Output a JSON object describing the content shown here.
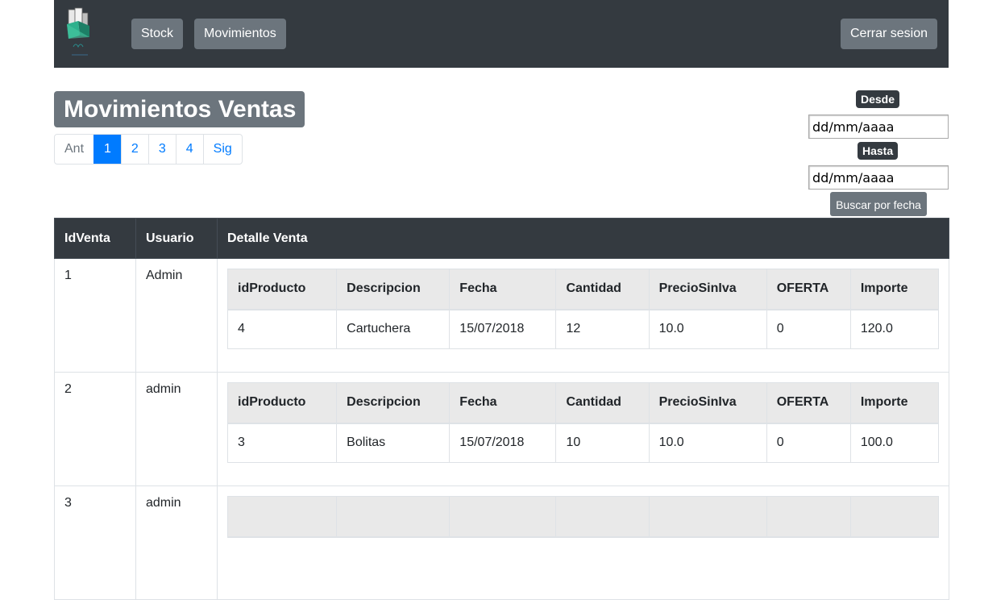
{
  "navbar": {
    "logo_icon": "books-logo",
    "stock_label": "Stock",
    "movimientos_label": "Movimientos",
    "logout_label": "Cerrar sesion"
  },
  "header": {
    "title": "Movimientos Ventas"
  },
  "pagination": {
    "prev": "Ant",
    "pages": [
      "1",
      "2",
      "3",
      "4"
    ],
    "active": "1",
    "next": "Sig"
  },
  "filter": {
    "desde_label": "Desde",
    "hasta_label": "Hasta",
    "desde_value": "dd/mm/aaaa",
    "hasta_value": "dd/mm/aaaa",
    "search_label": "Buscar por fecha"
  },
  "table": {
    "columns": [
      "IdVenta",
      "Usuario",
      "Detalle Venta"
    ],
    "detail_columns": [
      "idProducto",
      "Descripcion",
      "Fecha",
      "Cantidad",
      "PrecioSinIva",
      "OFERTA",
      "Importe"
    ],
    "rows": [
      {
        "id": "1",
        "user": "Admin",
        "detail": [
          "4",
          "Cartuchera",
          "15/07/2018",
          "12",
          "10.0",
          "0",
          "120.0"
        ]
      },
      {
        "id": "2",
        "user": "admin",
        "detail": [
          "3",
          "Bolitas",
          "15/07/2018",
          "10",
          "10.0",
          "0",
          "100.0"
        ]
      },
      {
        "id": "3",
        "user": "admin",
        "detail": []
      }
    ]
  },
  "colors": {
    "navbar": "#343a40",
    "secondary": "#6c757d",
    "primary": "#007bff"
  }
}
